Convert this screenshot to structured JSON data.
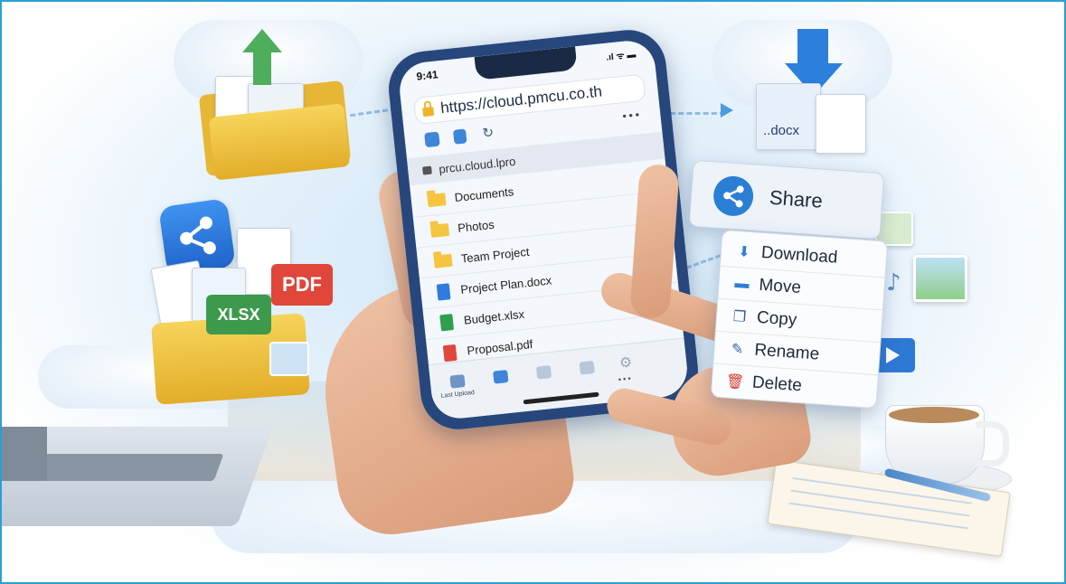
{
  "phone": {
    "time": "9:41",
    "signal": ".ıl ᯤ ▬",
    "url": "https://cloud.pmcu.co.th",
    "more": "•••",
    "breadcrumb": "prcu.cloud.lpro",
    "folders": [
      {
        "label": "Documents"
      },
      {
        "label": "Photos"
      },
      {
        "label": "Team Project"
      }
    ],
    "files": [
      {
        "label": "Project Plan.docx",
        "color": "#2f7be0"
      },
      {
        "label": "Budget.xlsx",
        "color": "#2e9e4f"
      },
      {
        "label": "Proposal.pdf",
        "color": "#e0463a"
      }
    ],
    "nav_caption": "Last Upload",
    "nav_more": "•••"
  },
  "context_menu": {
    "share_label": "Share",
    "items": [
      {
        "label": "Download",
        "icon": "download-icon",
        "glyph": "⬇"
      },
      {
        "label": "Move",
        "icon": "folder-icon",
        "glyph": "▬"
      },
      {
        "label": "Copy",
        "icon": "copy-icon",
        "glyph": "❐"
      },
      {
        "label": "Rename",
        "icon": "pencil-icon",
        "glyph": "✎"
      },
      {
        "label": "Delete",
        "icon": "trash-icon",
        "glyph": "🗑"
      }
    ]
  },
  "floating": {
    "pdf_badge": "PDF",
    "xlsx_badge": "XLSX",
    "docx_label": "..docx"
  },
  "colors": {
    "phone_frame": "#27477c",
    "accent_blue": "#2a7fd4",
    "folder_yellow": "#f5c542",
    "pdf_red": "#e0463a",
    "xlsx_green": "#3d9a4d",
    "delete_red": "#d33a2c"
  }
}
